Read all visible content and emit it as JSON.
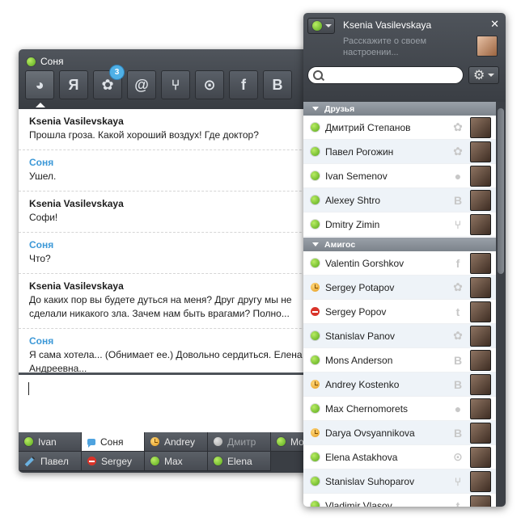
{
  "chat": {
    "title": "Соня",
    "tabs": [
      {
        "icon": "chat-bubble-icon",
        "glyph": "◕"
      },
      {
        "icon": "yandex-icon",
        "glyph": "Я"
      },
      {
        "icon": "flower-icon",
        "glyph": "✿",
        "badge": "3"
      },
      {
        "icon": "at-icon",
        "glyph": "@"
      },
      {
        "icon": "network-icon",
        "glyph": "⑂"
      },
      {
        "icon": "lightbulb-icon",
        "glyph": "⊙"
      },
      {
        "icon": "facebook-icon",
        "glyph": "f"
      },
      {
        "icon": "vkontakte-icon",
        "glyph": "B"
      }
    ],
    "messages": [
      {
        "sender": "Ksenia Vasilevskaya",
        "self": false,
        "text": "Прошла гроза. Какой хороший воздух! Где доктор?"
      },
      {
        "sender": "Соня",
        "self": true,
        "text": "Ушел."
      },
      {
        "sender": "Ksenia Vasilevskaya",
        "self": false,
        "text": "Софи!"
      },
      {
        "sender": "Соня",
        "self": true,
        "text": "Что?"
      },
      {
        "sender": "Ksenia Vasilevskaya",
        "self": false,
        "text": "До каких пор вы будете дуться на меня? Друг другу мы не сделали никакого зла. Зачем нам быть врагами? Полно..."
      },
      {
        "sender": "Соня",
        "self": true,
        "text": "Я сама хотела... (Обнимает ее.) Довольно сердиться. Елена Андреевна..."
      }
    ],
    "input_value": "",
    "bottom_tabs": [
      {
        "label": "Ivan",
        "status": "online",
        "active": false
      },
      {
        "label": "Соня",
        "status": "typing",
        "active": true
      },
      {
        "label": "Andrey",
        "status": "away",
        "active": false
      },
      {
        "label": "Дмитр",
        "status": "offline",
        "active": false
      },
      {
        "label": "Mo",
        "status": "online",
        "active": false
      },
      {
        "label": "Павел",
        "status": "writing",
        "active": false
      },
      {
        "label": "Sergey",
        "status": "busy",
        "active": false
      },
      {
        "label": "Max",
        "status": "online",
        "active": false
      },
      {
        "label": "Elena",
        "status": "online",
        "active": false
      }
    ]
  },
  "contacts": {
    "user_name": "Ksenia Vasilevskaya",
    "mood_placeholder": "Расскажите о своем настроении...",
    "close_glyph": "✕",
    "gear_glyph": "⚙",
    "search_value": "",
    "groups": [
      {
        "name": "Друзья",
        "items": [
          {
            "name": "Дмитрий Степанов",
            "status": "online",
            "service": "flower",
            "glyph": "✿"
          },
          {
            "name": "Павел Рогожин",
            "status": "online",
            "service": "flower",
            "glyph": "✿"
          },
          {
            "name": "Ivan Semenov",
            "status": "online",
            "service": "chat",
            "glyph": "●"
          },
          {
            "name": "Alexey Shtro",
            "status": "online",
            "service": "vkontakte",
            "glyph": "B"
          },
          {
            "name": "Dmitry Zimin",
            "status": "online",
            "service": "network",
            "glyph": "⑂"
          }
        ]
      },
      {
        "name": "Амигос",
        "items": [
          {
            "name": "Valentin Gorshkov",
            "status": "online",
            "service": "facebook",
            "glyph": "f"
          },
          {
            "name": "Sergey Potapov",
            "status": "away",
            "service": "flower",
            "glyph": "✿"
          },
          {
            "name": "Sergey Popov",
            "status": "busy",
            "service": "twitter",
            "glyph": "t"
          },
          {
            "name": "Stanislav Panov",
            "status": "online",
            "service": "flower",
            "glyph": "✿"
          },
          {
            "name": "Mons Anderson",
            "status": "online",
            "service": "vkontakte",
            "glyph": "B"
          },
          {
            "name": "Andrey Kostenko",
            "status": "away",
            "service": "vkontakte",
            "glyph": "B"
          },
          {
            "name": "Max Chernomorets",
            "status": "online",
            "service": "chat",
            "glyph": "●"
          },
          {
            "name": "Darya Ovsyannikova",
            "status": "away",
            "service": "vkontakte",
            "glyph": "B"
          },
          {
            "name": "Elena Astakhova",
            "status": "online",
            "service": "lightbulb",
            "glyph": "⊙"
          },
          {
            "name": "Stanislav Suhoparov",
            "status": "online",
            "service": "network",
            "glyph": "⑂"
          },
          {
            "name": "Vladimir Vlasov",
            "status": "online",
            "service": "twitter",
            "glyph": "t"
          }
        ]
      }
    ]
  }
}
